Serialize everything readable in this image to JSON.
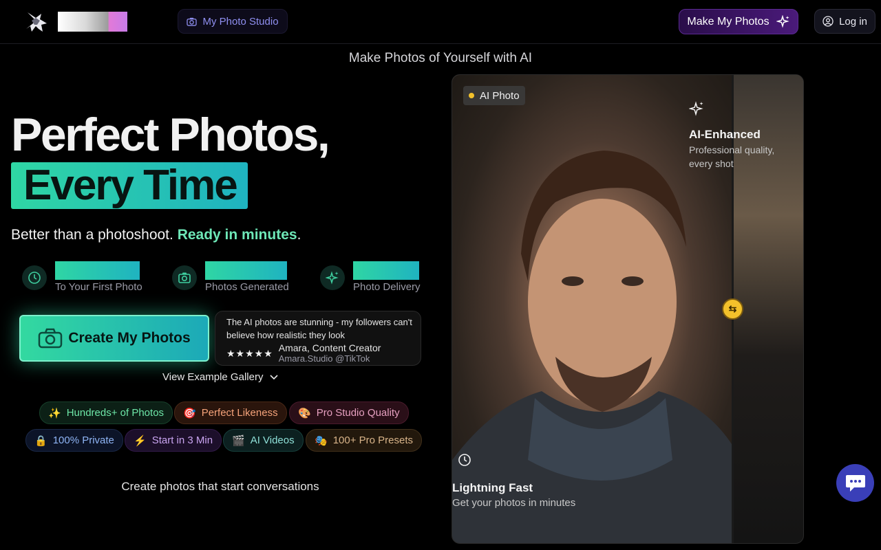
{
  "header": {
    "nav_studio": "My Photo Studio",
    "make_button": "Make My Photos",
    "login_button": "Log in"
  },
  "tagline": "Make Photos of Yourself with AI",
  "hero": {
    "line1": "Perfect Photos,",
    "line2": "Every Time",
    "sub_start": "Better than a photoshoot.",
    "sub_highlight": "Ready in minutes",
    "sub_end": "."
  },
  "stats": [
    {
      "icon": "clock-icon",
      "label": "To Your First Photo"
    },
    {
      "icon": "camera-icon",
      "label": "Photos Generated"
    },
    {
      "icon": "sparkles-icon",
      "label": "Photo Delivery"
    }
  ],
  "cta": {
    "label": "Create My Photos"
  },
  "testimonial": {
    "quote": "The AI photos are stunning - my followers can't believe how realistic they look",
    "stars": "★★★★★",
    "name": "Amara, Content Creator",
    "handle": "Amara.Studio @TikTok"
  },
  "gallery_link": "View Example Gallery",
  "tags": [
    {
      "emoji": "✨",
      "label": "Hundreds+ of Photos",
      "color": "#6ee7a8"
    },
    {
      "emoji": "🎯",
      "label": "Perfect Likeness",
      "color": "#f5a37a"
    },
    {
      "emoji": "🎨",
      "label": "Pro Studio Quality",
      "color": "#e6a0c0"
    },
    {
      "emoji": "🔒",
      "label": "100% Private",
      "color": "#8fb5f5"
    },
    {
      "emoji": "⚡",
      "label": "Start in 3 Min",
      "color": "#c9a4f0"
    },
    {
      "emoji": "🎬",
      "label": "AI Videos",
      "color": "#8fe0d8"
    },
    {
      "emoji": "🎭",
      "label": "100+ Pro Presets",
      "color": "#d8b48a"
    }
  ],
  "conversation": "Create photos that start conversations",
  "photo": {
    "badge": "AI Photo",
    "enhanced_title": "AI-Enhanced",
    "enhanced_text": "Professional quality, every shot",
    "fast_title": "Lightning Fast",
    "fast_text": "Get your photos in minutes"
  }
}
